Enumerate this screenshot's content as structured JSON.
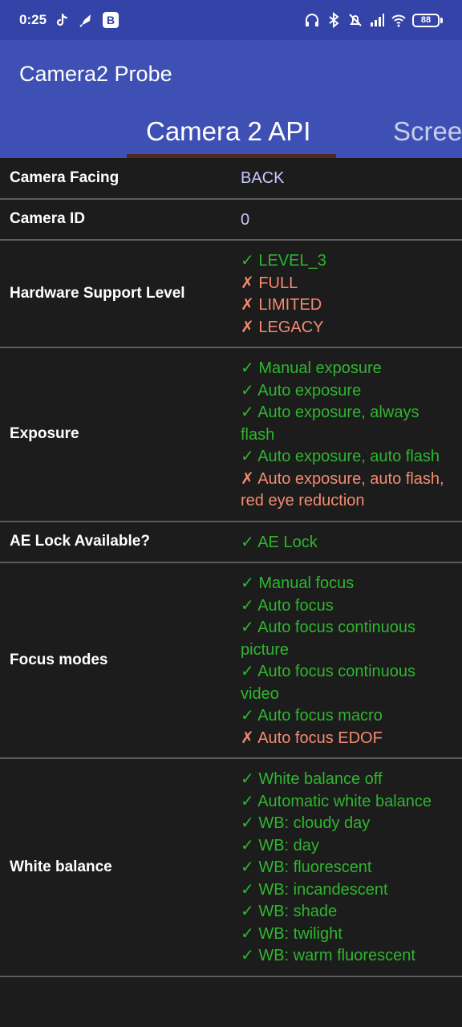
{
  "status_bar": {
    "time": "0:25",
    "battery": "88",
    "left_icons": [
      "tiktok-icon",
      "rocket-icon",
      "b-icon"
    ],
    "right_icons": [
      "headphones-icon",
      "bluetooth-icon",
      "bell-off-icon",
      "signal-icon",
      "wifi-icon",
      "battery-icon"
    ],
    "b_badge": "B"
  },
  "app_bar": {
    "title": "Camera2 Probe"
  },
  "tabs": [
    {
      "label": "Camera 2 API",
      "active": true
    },
    {
      "label": "Scree",
      "active": false
    }
  ],
  "colors": {
    "status_bar": "#3343a7",
    "app_bar": "#3e50b4",
    "ok": "#2fb52f",
    "no": "#f58a70",
    "plain": "#c8c8ff",
    "background": "#1c1c1c",
    "tab_indicator": "#4e2a1e"
  },
  "rows": [
    {
      "label": "Camera Facing",
      "value": "BACK"
    },
    {
      "label": "Camera ID",
      "value": "0"
    },
    {
      "label": "Hardware Support Level",
      "items": [
        {
          "mark": "✓",
          "ok": true,
          "text": "LEVEL_3"
        },
        {
          "mark": "✗",
          "ok": false,
          "text": "FULL"
        },
        {
          "mark": "✗",
          "ok": false,
          "text": "LIMITED"
        },
        {
          "mark": "✗",
          "ok": false,
          "text": "LEGACY"
        }
      ]
    },
    {
      "label": "Exposure",
      "items": [
        {
          "mark": "✓",
          "ok": true,
          "text": "Manual exposure"
        },
        {
          "mark": "✓",
          "ok": true,
          "text": "Auto exposure"
        },
        {
          "mark": "✓",
          "ok": true,
          "text": "Auto exposure, always flash"
        },
        {
          "mark": "✓",
          "ok": true,
          "text": "Auto exposure, auto flash"
        },
        {
          "mark": "✗",
          "ok": false,
          "text": "Auto exposure, auto flash, red eye reduction"
        }
      ]
    },
    {
      "label": "AE Lock Available?",
      "items": [
        {
          "mark": "✓",
          "ok": true,
          "text": "AE Lock"
        }
      ]
    },
    {
      "label": "Focus modes",
      "items": [
        {
          "mark": "✓",
          "ok": true,
          "text": "Manual focus"
        },
        {
          "mark": "✓",
          "ok": true,
          "text": "Auto focus"
        },
        {
          "mark": "✓",
          "ok": true,
          "text": "Auto focus continuous picture"
        },
        {
          "mark": "✓",
          "ok": true,
          "text": "Auto focus continuous video"
        },
        {
          "mark": "✓",
          "ok": true,
          "text": "Auto focus macro"
        },
        {
          "mark": "✗",
          "ok": false,
          "text": "Auto focus EDOF"
        }
      ]
    },
    {
      "label": "White balance",
      "items": [
        {
          "mark": "✓",
          "ok": true,
          "text": "White balance off"
        },
        {
          "mark": "✓",
          "ok": true,
          "text": "Automatic white balance"
        },
        {
          "mark": "✓",
          "ok": true,
          "text": "WB: cloudy day"
        },
        {
          "mark": "✓",
          "ok": true,
          "text": "WB: day"
        },
        {
          "mark": "✓",
          "ok": true,
          "text": "WB: fluorescent"
        },
        {
          "mark": "✓",
          "ok": true,
          "text": "WB: incandescent"
        },
        {
          "mark": "✓",
          "ok": true,
          "text": "WB: shade"
        },
        {
          "mark": "✓",
          "ok": true,
          "text": "WB: twilight"
        },
        {
          "mark": "✓",
          "ok": true,
          "text": "WB: warm fluorescent"
        }
      ]
    }
  ]
}
